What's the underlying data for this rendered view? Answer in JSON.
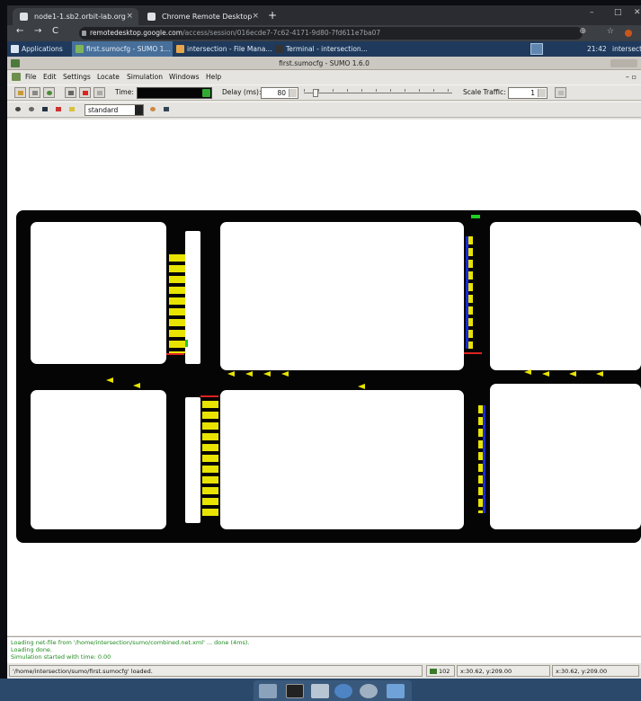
{
  "browser": {
    "tabs": [
      {
        "label": "node1-1.sb2.orbit-lab.org",
        "close": "×"
      },
      {
        "label": "Chrome Remote Desktop",
        "close": "×"
      }
    ],
    "new_tab": "+",
    "window_controls": [
      "–",
      "□",
      "✕"
    ],
    "nav": [
      "←",
      "→",
      "C"
    ],
    "url_domain": "remotedesktop.google.com",
    "url_path": "/access/session/016ecde7-7c62-4171-9d80-7fd611e7ba07",
    "omnibox_icons": "⊕ ☆"
  },
  "panel": {
    "applications": "Applications",
    "tasks": [
      "first.sumocfg - SUMO 1...",
      "intersection - File Mana...",
      "Terminal - intersection..."
    ],
    "clock": "21:42",
    "host": "intersect"
  },
  "sumo": {
    "title": "first.sumocfg - SUMO 1.6.0",
    "menu": [
      "File",
      "Edit",
      "Settings",
      "Locate",
      "Simulation",
      "Windows",
      "Help"
    ],
    "time_label": "Time:",
    "delay_label": "Delay (ms):",
    "delay_value": "80",
    "scale_label": "Scale Traffic:",
    "scale_value": "1",
    "scheme": "standard",
    "scale_bar": {
      "start": "0",
      "end": "10m"
    },
    "log": [
      "Loading net-file from '/home/intersection/sumo/combined.net.xml' ... done (4ms).",
      "Loading done.",
      "Simulation started with time: 0.00"
    ],
    "status": {
      "message": "'/home/intersection/sumo/first.sumocfg' loaded.",
      "count": "102",
      "coord1": "x:30.62, y:209.00",
      "coord2": "x:30.62, y:209.00"
    }
  },
  "colors": {
    "road": "#050505",
    "vehicle": "#e8e400",
    "signal_red": "#d22",
    "signal_green": "#2c2",
    "lane_blue": "#1b2ad6"
  }
}
